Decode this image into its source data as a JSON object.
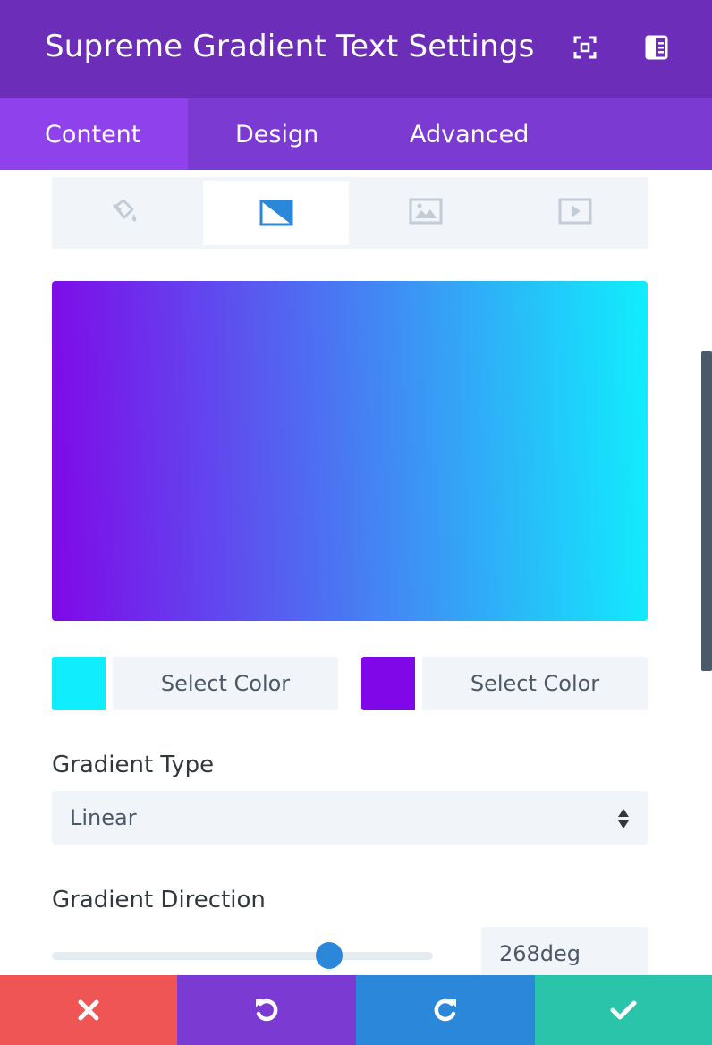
{
  "header": {
    "title": "Supreme Gradient Text Settings",
    "icons": [
      "fullscreen-icon",
      "sidebar-layout-icon"
    ]
  },
  "tabs": [
    {
      "label": "Content",
      "active": true
    },
    {
      "label": "Design",
      "active": false
    },
    {
      "label": "Advanced",
      "active": false
    }
  ],
  "background_types": [
    {
      "icon": "paint-bucket-icon",
      "active": false
    },
    {
      "icon": "gradient-icon",
      "active": true
    },
    {
      "icon": "image-icon",
      "active": false
    },
    {
      "icon": "video-icon",
      "active": false
    }
  ],
  "gradient": {
    "start_color": "#10eefd",
    "end_color": "#8008e8",
    "picker_1": {
      "label": "Select Color",
      "color": "#10eefd"
    },
    "picker_2": {
      "label": "Select Color",
      "color": "#8008e8"
    },
    "type_label": "Gradient Type",
    "type_value": "Linear",
    "direction_label": "Gradient Direction",
    "direction_value": "268deg",
    "direction_degrees": 268,
    "direction_max_degrees": 360
  },
  "footer": {
    "buttons": [
      {
        "icon": "close-icon",
        "color": "#ef5555"
      },
      {
        "icon": "undo-icon",
        "color": "#7b3ad1"
      },
      {
        "icon": "redo-icon",
        "color": "#2b87da"
      },
      {
        "icon": "check-icon",
        "color": "#29c4a9"
      }
    ]
  },
  "colors": {
    "header_bg": "#6c2eb9",
    "tabs_bg": "#7b3ad1",
    "active_tab_bg": "#8f42ec",
    "accent_blue": "#2b87da"
  }
}
